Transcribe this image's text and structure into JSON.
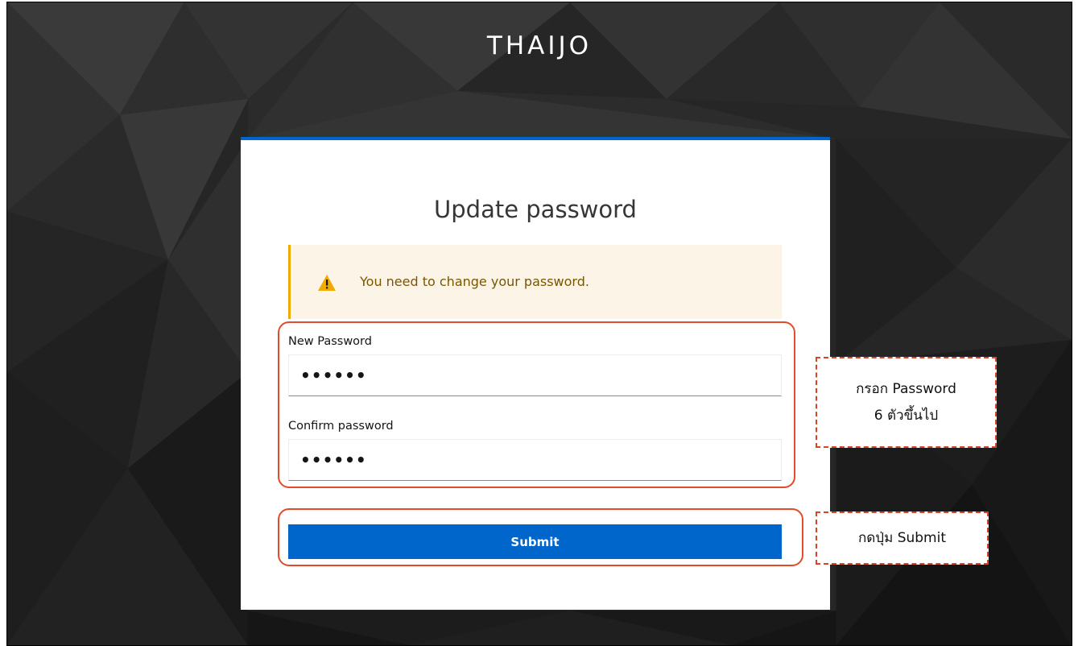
{
  "brand": "THAIJO",
  "card": {
    "title": "Update password",
    "accent_color": "#0066cc"
  },
  "alert": {
    "icon": "warning-triangle-icon",
    "message": "You need to change your password.",
    "color": "#f0ab00"
  },
  "form": {
    "new_password": {
      "label": "New Password",
      "value": "••••••"
    },
    "confirm_password": {
      "label": "Confirm password",
      "value": "••••••"
    },
    "submit_label": "Submit"
  },
  "annotations": {
    "password_note_line1": "กรอก Password",
    "password_note_line2": "6 ตัวขึ้นไป",
    "submit_note": "กดปุ่ม Submit",
    "color": "#e14c2b"
  }
}
